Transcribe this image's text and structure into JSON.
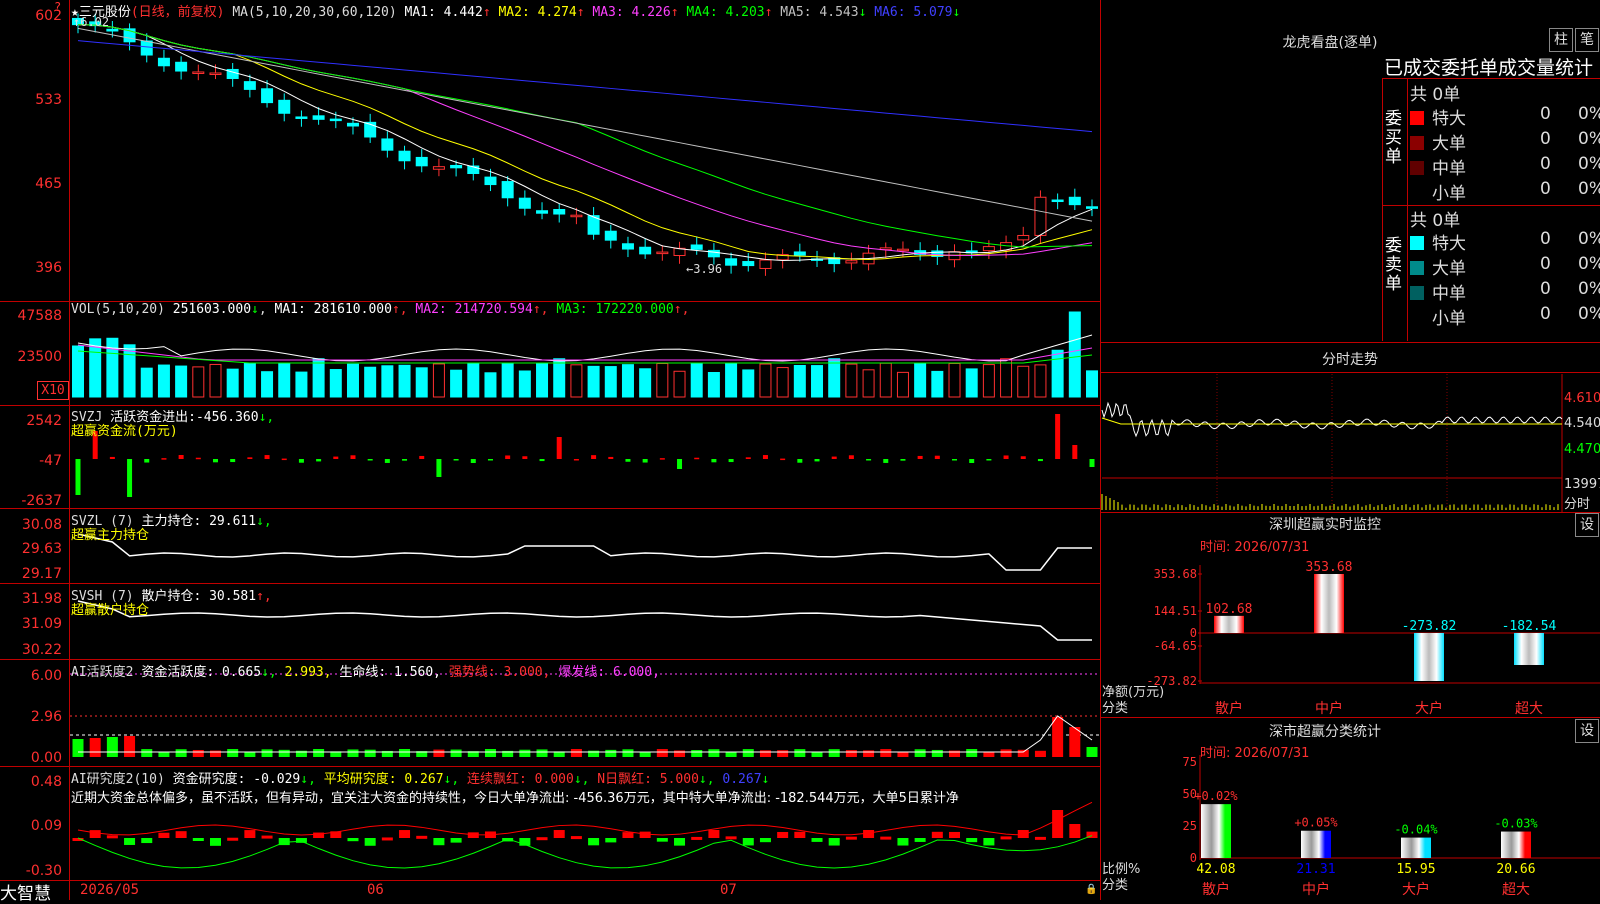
{
  "app": {
    "name": "大智慧"
  },
  "kline": {
    "star": "★",
    "stock_name": "三元股份",
    "mode": "(日线，前复权)",
    "ma_header": "MA(5,10,20,30,60,120)",
    "ma_values": [
      {
        "label": "MA1:",
        "value": "4.442",
        "arrow": "↑",
        "color": "#ffffff"
      },
      {
        "label": "MA2:",
        "value": "4.274",
        "arrow": "↑",
        "color": "#ffff00"
      },
      {
        "label": "MA3:",
        "value": "4.226",
        "arrow": "↑",
        "color": "#ff40ff"
      },
      {
        "label": "MA4:",
        "value": "4.203",
        "arrow": "↑",
        "color": "#00ff00"
      },
      {
        "label": "MA5:",
        "value": "4.543",
        "arrow": "↓",
        "color": "#c0c0c0"
      },
      {
        "label": "MA6:",
        "value": "5.079",
        "arrow": "↓",
        "color": "#4040ff"
      }
    ],
    "y_ticks": [
      "602",
      "533",
      "465",
      "396"
    ],
    "high_label": "6.02",
    "low_label": "←3.96",
    "corner_mark": "?"
  },
  "volume": {
    "header": "VOL(5,10,20)",
    "value": "251603.000",
    "value_arrow": "↓",
    "ma": [
      {
        "label": "MA1:",
        "value": "281610.000",
        "arrow": "↑",
        "color": "#ffffff"
      },
      {
        "label": "MA2:",
        "value": "214720.594",
        "arrow": "↑",
        "color": "#ff40ff"
      },
      {
        "label": "MA3:",
        "value": "172220.000",
        "arrow": "↑",
        "color": "#00ff00"
      }
    ],
    "y_ticks": [
      "47588",
      "23500"
    ],
    "unit": "X10"
  },
  "svzj": {
    "header": "SVZJ",
    "label": "活跃资金进出:",
    "value": "-456.360",
    "arrow": "↓,",
    "sub": "超赢资金流(万元)",
    "y_ticks": [
      "2542",
      "-47",
      "-2637"
    ]
  },
  "svzl": {
    "header": "SVZL (7)",
    "label": "主力持仓:",
    "value": "29.611",
    "arrow": "↓,",
    "sub": "超赢主力持仓",
    "y_ticks": [
      "30.08",
      "29.63",
      "29.17"
    ]
  },
  "svsh": {
    "header": "SVSH (7)",
    "label": "散户持仓:",
    "value": "30.581",
    "arrow": "↑,",
    "sub": "超赢散户持仓",
    "y_ticks": [
      "31.98",
      "31.09",
      "30.22"
    ]
  },
  "ai_active": {
    "header": "AI活跃度2",
    "label": "资金活跃度:",
    "v1": "0.665",
    "a1": "↓,",
    "v2": "2.993,",
    "life_label": "生命线:",
    "life": "1.560,",
    "strong": "强势线: 3.000,",
    "burst": "爆发线: 6.000,",
    "y_ticks": [
      "6.00",
      "2.96",
      "0.00"
    ]
  },
  "ai_research": {
    "header": "AI研究度2(10)",
    "label": "资金研究度:",
    "value": "-0.029",
    "a1": "↓,",
    "avg": "平均研究度: 0.267",
    "a2": "↓,",
    "consec": "连续飘红: 0.000",
    "a3": "↓,",
    "nday": "N日飘红: 5.000",
    "a4": "↓,",
    "last": "0.267",
    "a5": "↓",
    "commentary": "近期大资金总体偏多，虽不活跃，但有异动，宜关注大资金的持续性，今日大单净流出: -456.36万元，其中特大单净流出: -182.544万元，大单5日累计净",
    "y_ticks": [
      "0.48",
      "0.09",
      "-0.30"
    ]
  },
  "xaxis": {
    "labels": [
      "2026/05",
      "06",
      "07"
    ]
  },
  "dragon": {
    "title": "龙虎看盘(逐单)",
    "btn1": "柱",
    "btn2": "笔",
    "subtitle": "已成交委托单成交量统计",
    "buy": {
      "side_label": "委买单",
      "total": "共 0单",
      "rows": [
        {
          "name": "特大",
          "val": "0",
          "pct": "0%",
          "color": "#ff0000"
        },
        {
          "name": "大单",
          "val": "0",
          "pct": "0%",
          "color": "#8b0000"
        },
        {
          "name": "中单",
          "val": "0",
          "pct": "0%",
          "color": "#600000"
        },
        {
          "name": "小单",
          "val": "0",
          "pct": "0%",
          "color": "#000000"
        }
      ]
    },
    "sell": {
      "side_label": "委卖单",
      "total": "共 0单",
      "rows": [
        {
          "name": "特大",
          "val": "0",
          "pct": "0%",
          "color": "#00ffff"
        },
        {
          "name": "大单",
          "val": "0",
          "pct": "0%",
          "color": "#008b8b"
        },
        {
          "name": "中单",
          "val": "0",
          "pct": "0%",
          "color": "#006060"
        },
        {
          "name": "小单",
          "val": "0",
          "pct": "0%",
          "color": "#000000"
        }
      ]
    }
  },
  "intraday": {
    "title": "分时走势",
    "y_ticks": [
      "4.610",
      "4.540",
      "4.470"
    ],
    "vol_tick": "13997",
    "vol_label": "分时"
  },
  "sz_monitor": {
    "title": "深圳超赢实时监控",
    "btn": "设",
    "time": "时间: 2026/07/31",
    "y_ticks": [
      "353.68",
      "144.51",
      "0",
      "-64.65",
      "-273.82"
    ],
    "net_label": "净额(万元)",
    "cat_label": "分类",
    "categories": [
      "散户",
      "中户",
      "大户",
      "超大"
    ],
    "values": [
      102.68,
      353.68,
      -273.82,
      -182.54
    ],
    "value_labels": [
      "102.68",
      "353.68",
      "-273.82",
      "-182.54"
    ]
  },
  "sz_category": {
    "title": "深市超赢分类统计",
    "btn": "设",
    "time": "时间: 2026/07/31",
    "y_ticks": [
      "75",
      "50",
      "25",
      "0"
    ],
    "ratio_label": "比例%",
    "cat_label": "分类",
    "categories": [
      "散户",
      "中户",
      "大户",
      "超大"
    ],
    "values": [
      42.08,
      21.31,
      15.95,
      20.66
    ],
    "changes": [
      "+0.02%",
      "+0.05%",
      "-0.04%",
      "-0.03%"
    ]
  }
}
